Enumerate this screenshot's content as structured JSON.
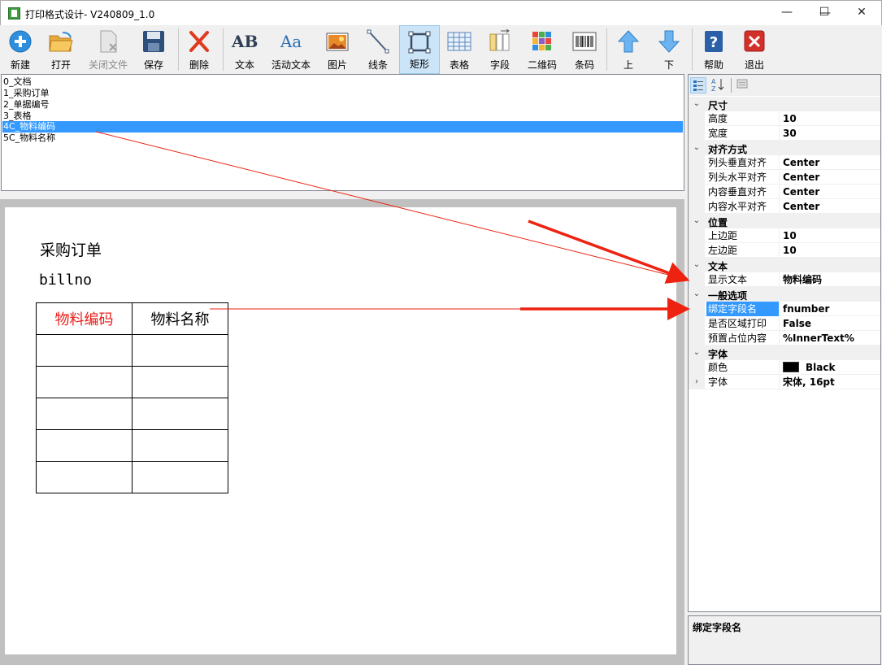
{
  "window": {
    "title": "打印格式设计- V240809_1.0",
    "controls": {
      "minimize": "—",
      "maximize": "☐",
      "close": "✕"
    }
  },
  "toolbar": {
    "buttons": [
      {
        "label": "新建",
        "icon": "new-icon"
      },
      {
        "label": "打开",
        "icon": "open-folder-icon"
      },
      {
        "label": "关闭文件",
        "icon": "close-file-icon",
        "disabled": true
      },
      {
        "label": "保存",
        "icon": "save-icon"
      },
      {
        "label": "删除",
        "icon": "delete-icon"
      },
      {
        "label": "文本",
        "icon": "text-icon",
        "glyph": "AB"
      },
      {
        "label": "活动文本",
        "icon": "dynamic-text-icon",
        "glyph": "Aa"
      },
      {
        "label": "图片",
        "icon": "image-icon"
      },
      {
        "label": "线条",
        "icon": "line-icon"
      },
      {
        "label": "矩形",
        "icon": "rectangle-icon",
        "active": true
      },
      {
        "label": "表格",
        "icon": "table-icon"
      },
      {
        "label": "字段",
        "icon": "field-icon"
      },
      {
        "label": "二维码",
        "icon": "qrcode-icon"
      },
      {
        "label": "条码",
        "icon": "barcode-icon"
      },
      {
        "label": "上",
        "icon": "arrow-up-icon"
      },
      {
        "label": "下",
        "icon": "arrow-down-icon"
      },
      {
        "label": "帮助",
        "icon": "help-icon"
      },
      {
        "label": "退出",
        "icon": "exit-icon"
      }
    ]
  },
  "tree": {
    "items": [
      {
        "label": "0_文档"
      },
      {
        "label": "1_采购订单"
      },
      {
        "label": "2_单据编号"
      },
      {
        "label": "3_表格"
      },
      {
        "label": "4C_物料编码",
        "selected": true
      },
      {
        "label": "5C_物料名称"
      }
    ]
  },
  "canvas": {
    "title": "采购订单",
    "bill": "billno",
    "table": {
      "headers": [
        "物料编码",
        "物料名称"
      ],
      "highlight_color": "#e8201a",
      "empty_rows": 5
    }
  },
  "props": {
    "tool_icons": [
      "categorized-icon",
      "sort-alpha-icon",
      "property-pages-icon"
    ],
    "rows": [
      {
        "type": "category",
        "label": "尺寸"
      },
      {
        "type": "prop",
        "name": "高度",
        "value": "10"
      },
      {
        "type": "prop",
        "name": "宽度",
        "value": "30"
      },
      {
        "type": "category",
        "label": "对齐方式"
      },
      {
        "type": "prop",
        "name": "列头垂直对齐",
        "value": "Center"
      },
      {
        "type": "prop",
        "name": "列头水平对齐",
        "value": "Center"
      },
      {
        "type": "prop",
        "name": "内容垂直对齐",
        "value": "Center"
      },
      {
        "type": "prop",
        "name": "内容水平对齐",
        "value": "Center"
      },
      {
        "type": "category",
        "label": "位置"
      },
      {
        "type": "prop",
        "name": "上边距",
        "value": "10"
      },
      {
        "type": "prop",
        "name": "左边距",
        "value": "10"
      },
      {
        "type": "category",
        "label": "文本"
      },
      {
        "type": "prop",
        "name": "显示文本",
        "value": "物料编码"
      },
      {
        "type": "category",
        "label": "一般选项"
      },
      {
        "type": "prop",
        "name": "绑定字段名",
        "value": "fnumber",
        "selected": true
      },
      {
        "type": "prop",
        "name": "是否区域打印",
        "value": "False"
      },
      {
        "type": "prop",
        "name": "预置占位内容",
        "value": "%InnerText%"
      },
      {
        "type": "category",
        "label": "字体"
      },
      {
        "type": "prop",
        "name": "颜色",
        "value": "Black",
        "swatch": "#000000"
      },
      {
        "type": "prop",
        "name": "字体",
        "value": "宋体, 16pt",
        "expandable": true
      }
    ],
    "description_title": "绑定字段名"
  },
  "colors": {
    "selection": "#3399ff",
    "arrow": "#ee2211",
    "active_tool": "#cce4f7"
  }
}
